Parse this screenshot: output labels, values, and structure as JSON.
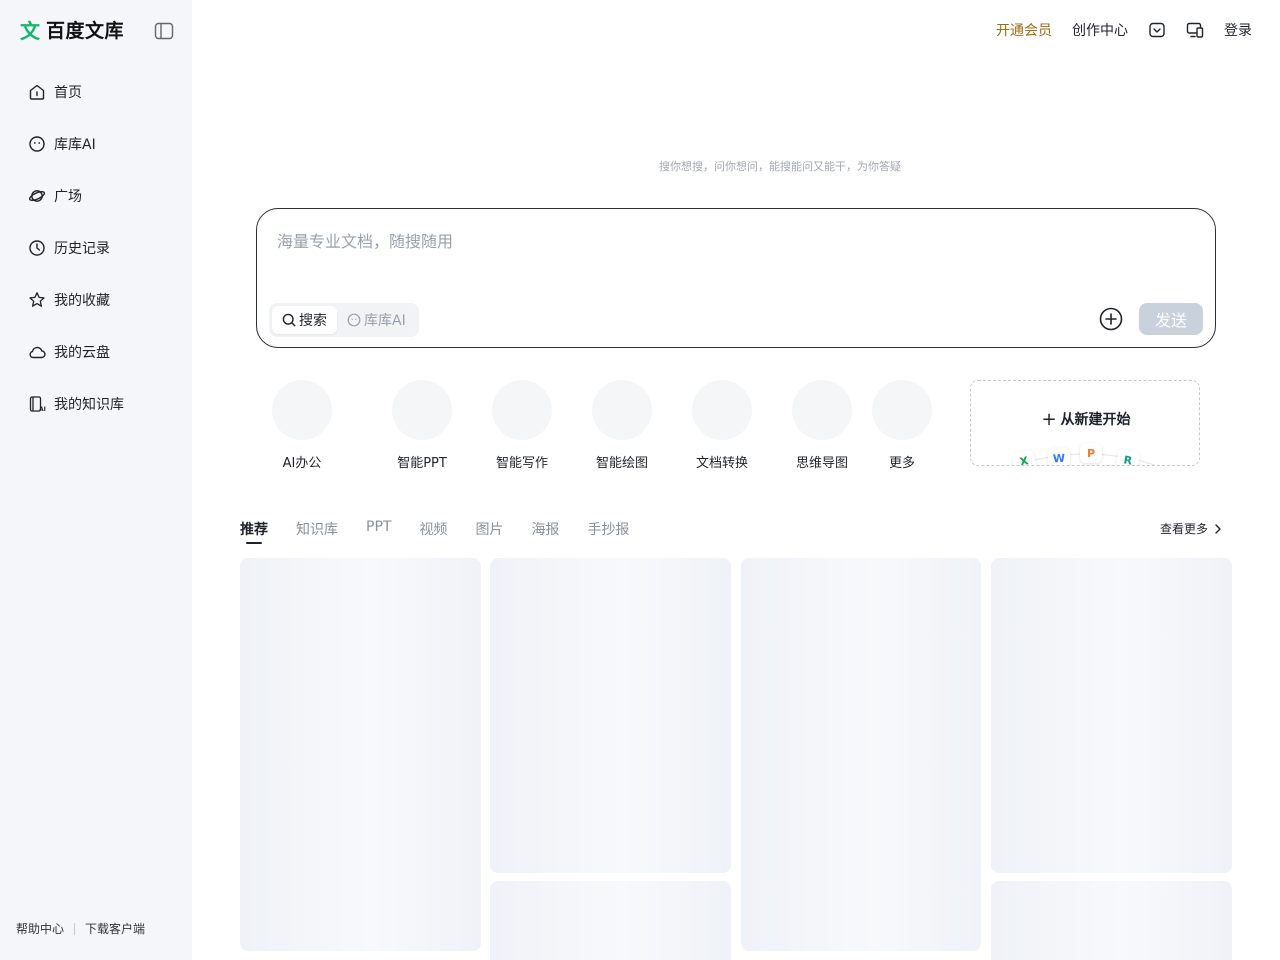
{
  "app": {
    "logo_mark": "文",
    "name": "百度文库"
  },
  "sidebar": {
    "items": [
      {
        "label": "首页",
        "icon": "home-icon"
      },
      {
        "label": "库库AI",
        "icon": "ai-face-icon"
      },
      {
        "label": "广场",
        "icon": "planet-icon"
      },
      {
        "label": "历史记录",
        "icon": "clock-icon"
      },
      {
        "label": "我的收藏",
        "icon": "star-icon"
      },
      {
        "label": "我的云盘",
        "icon": "cloud-icon"
      },
      {
        "label": "我的知识库",
        "icon": "knowledge-base-icon"
      }
    ],
    "footer": {
      "help": "帮助中心",
      "download": "下载客户端"
    }
  },
  "header": {
    "vip": "开通会员",
    "creator": "创作中心",
    "login": "登录",
    "icons": [
      "download-check-icon",
      "device-icon"
    ]
  },
  "hero": {
    "tagline": "搜你想搜，问你想问，能搜能问又能干，为你答疑"
  },
  "search": {
    "placeholder": "海量专业文档，随搜随用",
    "value": "",
    "modes": [
      "搜索",
      "库库AI"
    ],
    "active_mode": "搜索",
    "send": "发送"
  },
  "tools": [
    {
      "label": "AI办公"
    },
    {
      "label": "智能PPT"
    },
    {
      "label": "智能写作"
    },
    {
      "label": "智能绘图"
    },
    {
      "label": "文档转换"
    },
    {
      "label": "思维导图"
    },
    {
      "label": "更多"
    }
  ],
  "new_card": {
    "title": "从新建开始",
    "chips": [
      "X",
      "W",
      "P",
      "R"
    ]
  },
  "feed": {
    "tabs": [
      "推荐",
      "知识库",
      "PPT",
      "视频",
      "图片",
      "海报",
      "手抄报"
    ],
    "active_tab": "推荐",
    "view_more": "查看更多"
  },
  "colors": {
    "accent_green": "#10b86e",
    "vip_gold": "#a06a13",
    "sidebar_bg": "#f5f6fa",
    "send_disabled": "#c9d1dd"
  }
}
